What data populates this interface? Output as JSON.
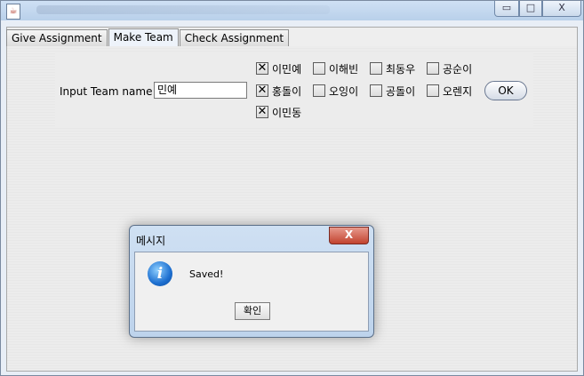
{
  "window": {
    "icon": "java-icon",
    "minimize": "▭",
    "maximize": "□",
    "close": "X"
  },
  "tabs": [
    {
      "label": "Give Assignment"
    },
    {
      "label": "Make Team"
    },
    {
      "label": "Check Assignment"
    }
  ],
  "team_form": {
    "label": "Input Team name :",
    "team_name_value": "민예",
    "members": [
      {
        "name": "이민예",
        "checked": true
      },
      {
        "name": "이해빈",
        "checked": false
      },
      {
        "name": "최동우",
        "checked": false
      },
      {
        "name": "공순이",
        "checked": false
      },
      {
        "name": "홍돌이",
        "checked": true
      },
      {
        "name": "오잉이",
        "checked": false
      },
      {
        "name": "공돌이",
        "checked": false
      },
      {
        "name": "오렌지",
        "checked": false
      },
      {
        "name": "이민동",
        "checked": true
      }
    ],
    "ok_label": "OK"
  },
  "dialog": {
    "title": "메시지",
    "close": "X",
    "icon": "info-icon",
    "message": "Saved!",
    "confirm_label": "확인"
  }
}
